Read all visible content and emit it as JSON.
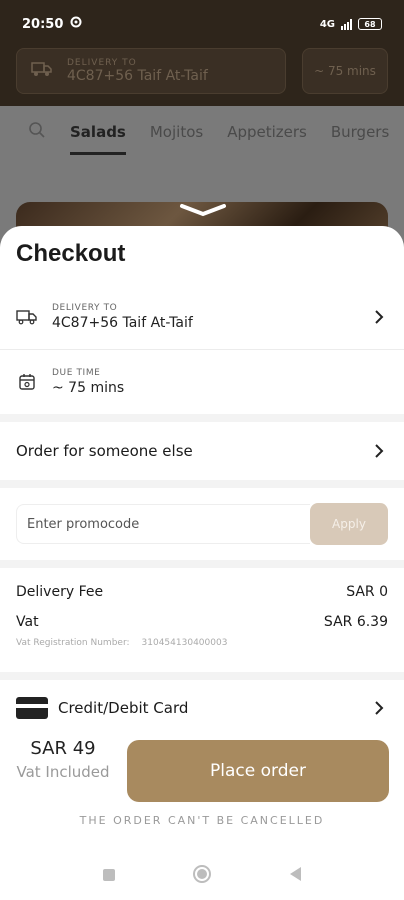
{
  "status_bar": {
    "time": "20:50",
    "network": "4G",
    "battery": "68"
  },
  "background": {
    "delivery_label": "DELIVERY TO",
    "delivery_value": "4C87+56 Taif At-Taif",
    "time_value": "~ 75 mins",
    "tabs": [
      "Salads",
      "Mojitos",
      "Appetizers",
      "Burgers"
    ],
    "active_tab": "Salads"
  },
  "checkout": {
    "title": "Checkout",
    "delivery": {
      "label": "DELIVERY TO",
      "value": "4C87+56 Taif At-Taif"
    },
    "due_time": {
      "label": "DUE TIME",
      "value": "~ 75 mins"
    },
    "order_for_someone": "Order for someone else",
    "promo": {
      "placeholder": "Enter promocode",
      "apply_label": "Apply"
    },
    "fees": {
      "delivery_fee_label": "Delivery Fee",
      "delivery_fee_value": "SAR 0",
      "vat_label": "Vat",
      "vat_value": "SAR 6.39",
      "vat_reg_label": "Vat Registration Number:",
      "vat_reg_value": "310454130400003"
    },
    "payment": {
      "label": "Credit/Debit Card"
    },
    "total": {
      "amount": "SAR 49",
      "sub": "Vat Included"
    },
    "place_order_label": "Place order",
    "note": "THE ORDER CAN'T BE CANCELLED"
  },
  "colors": {
    "accent": "#a88a5f",
    "apply_disabled": "#d8c9b8",
    "sheet_bg": "#f3f3f3"
  }
}
